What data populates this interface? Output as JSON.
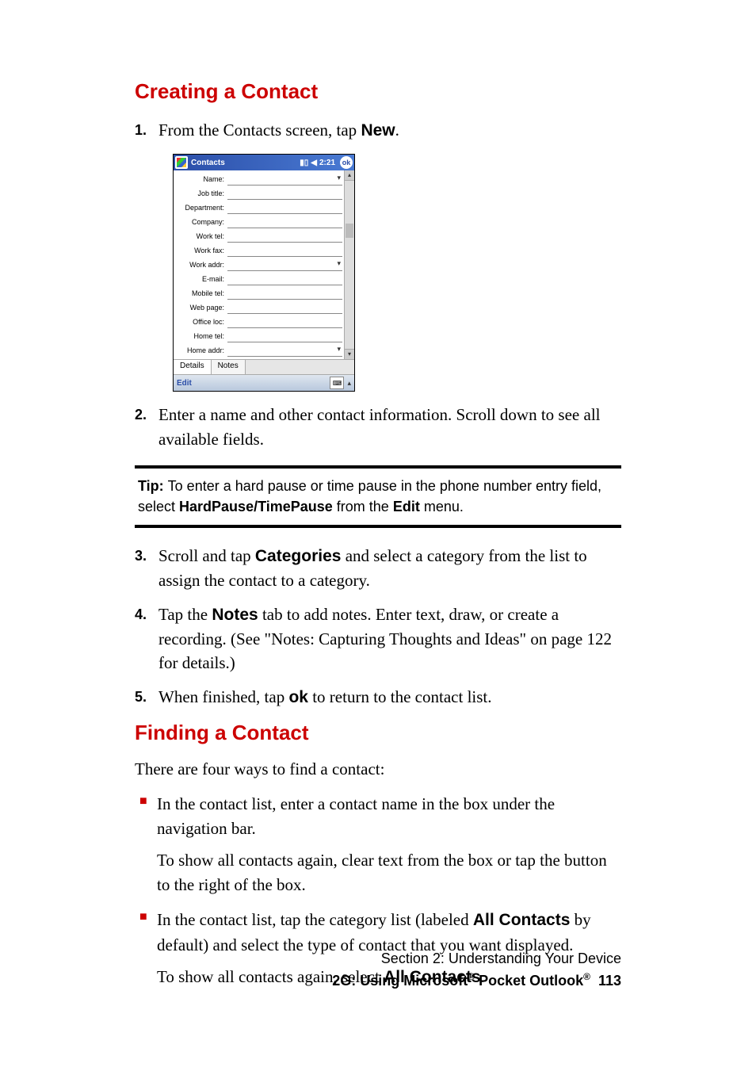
{
  "headings": {
    "creating": "Creating a Contact",
    "finding": "Finding a Contact"
  },
  "steps1": {
    "n1": "1.",
    "t1a": "From the Contacts screen, tap ",
    "t1b": "New",
    "t1c": "."
  },
  "steps2": {
    "n2": "2.",
    "t2": "Enter a name and other contact information. Scroll down to see all available fields."
  },
  "tip": {
    "label": "Tip: ",
    "a": "To enter a hard pause or time pause in the phone number entry field, select ",
    "b": "HardPause/TimePause",
    "c": " from the ",
    "d": "Edit",
    "e": " menu."
  },
  "steps3": {
    "n3": "3.",
    "t3a": "Scroll and tap ",
    "t3b": "Categories",
    "t3c": " and select a category from the list to assign the contact to a category.",
    "n4": "4.",
    "t4a": "Tap the ",
    "t4b": "Notes",
    "t4c": " tab to add notes. Enter text, draw, or create a recording. (See \"Notes: Capturing Thoughts and Ideas\" on page 122 for details.)",
    "n5": "5.",
    "t5a": "When finished, tap ",
    "t5b": "ok",
    "t5c": " to return to the contact list."
  },
  "finding_intro": "There are four ways to find a contact:",
  "bullets": {
    "b1": "In the contact list, enter a contact name in the box under the navigation bar.",
    "b1sub": "To show all contacts again, clear text from the box or tap the button to the right of the box.",
    "b2a": "In the contact list, tap the category list (labeled ",
    "b2b": "All Contacts",
    "b2c": " by default) and select the type of contact that you want displayed.",
    "b2suba": "To show all contacts again, select ",
    "b2subb": "All Contacts",
    "b2subc": "."
  },
  "footer": {
    "section": "Section 2: Understanding Your Device",
    "chapter_a": "2G: Using Microsoft",
    "chapter_b": " Pocket Outlook",
    "reg": "®",
    "page": "113"
  },
  "pocket": {
    "title": "Contacts",
    "time": "2:21",
    "ok": "ok",
    "fields": [
      "Name:",
      "Job title:",
      "Department:",
      "Company:",
      "Work tel:",
      "Work fax:",
      "Work addr:",
      "E-mail:",
      "Mobile tel:",
      "Web page:",
      "Office loc:",
      "Home tel:",
      "Home addr:"
    ],
    "tabs": {
      "details": "Details",
      "notes": "Notes"
    },
    "menu": "Edit"
  }
}
